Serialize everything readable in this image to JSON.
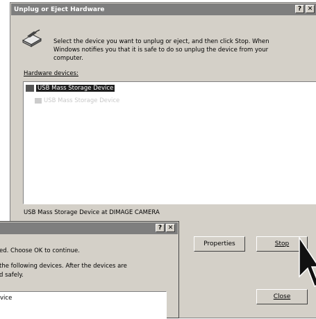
{
  "main_dialog": {
    "title": "Unplug or Eject Hardware",
    "help_button": "?",
    "close_button": "✕",
    "instructions_line1": "Select the device you want to unplug or eject, and then click Stop. When",
    "instructions_line2": "Windows notifies you that it is safe to do so unplug the device from your",
    "instructions_line3": "computer.",
    "devices_label": "Hardware devices:",
    "devices": [
      {
        "name": "USB Mass Storage Device",
        "selected": true
      },
      {
        "name": "USB Mass Storage Device",
        "selected": false
      }
    ],
    "device_status": "USB Mass Storage Device at DIMAGE CAMERA",
    "properties_button": "Properties",
    "stop_button": "Stop",
    "close_dialog_button": "Close"
  },
  "sub_dialog": {
    "help_button": "?",
    "close_button": "✕",
    "text_line1": "ed. Choose OK to continue.",
    "text_line2": "the following devices. After the devices are",
    "text_line3": "d safely.",
    "list_item": "vice"
  },
  "colors": {
    "titlebar": "#7e7e7e",
    "selection": "#1c1c1c",
    "face": "#d4d0c8"
  }
}
